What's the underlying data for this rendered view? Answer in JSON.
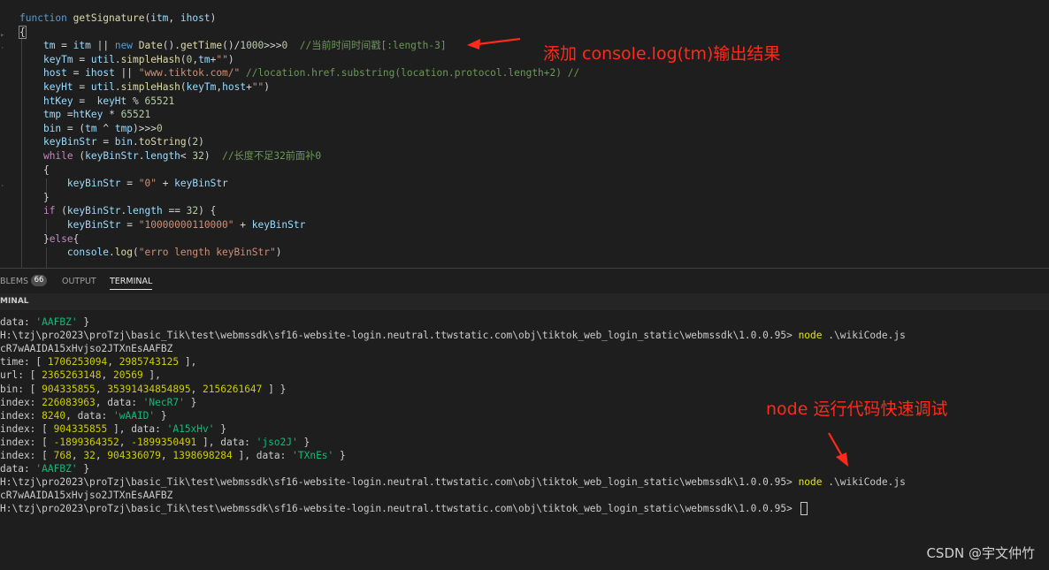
{
  "editor": {
    "lines": [
      [
        {
          "t": "function ",
          "c": "kw"
        },
        {
          "t": "getSignature",
          "c": "fn"
        },
        {
          "t": "(",
          "c": ""
        },
        {
          "t": "itm",
          "c": "var"
        },
        {
          "t": ", ",
          "c": ""
        },
        {
          "t": "ihost",
          "c": "var"
        },
        {
          "t": ")",
          "c": ""
        }
      ],
      [
        {
          "t": "{",
          "c": "brace-box"
        }
      ],
      [
        {
          "t": "    ",
          "c": ""
        },
        {
          "t": "tm",
          "c": "var"
        },
        {
          "t": " = ",
          "c": ""
        },
        {
          "t": "itm",
          "c": "var"
        },
        {
          "t": " || ",
          "c": ""
        },
        {
          "t": "new ",
          "c": "kw"
        },
        {
          "t": "Date",
          "c": "fn"
        },
        {
          "t": "().",
          "c": ""
        },
        {
          "t": "getTime",
          "c": "fn"
        },
        {
          "t": "()/",
          "c": ""
        },
        {
          "t": "1000",
          "c": "num"
        },
        {
          "t": ">>>",
          "c": ""
        },
        {
          "t": "0",
          "c": "num"
        },
        {
          "t": "  //当前时间时间戳[:length-3]",
          "c": "cmt"
        }
      ],
      [
        {
          "t": "    ",
          "c": ""
        },
        {
          "t": "keyTm",
          "c": "var"
        },
        {
          "t": " = ",
          "c": ""
        },
        {
          "t": "util",
          "c": "var"
        },
        {
          "t": ".",
          "c": ""
        },
        {
          "t": "simpleHash",
          "c": "fn"
        },
        {
          "t": "(",
          "c": ""
        },
        {
          "t": "0",
          "c": "num"
        },
        {
          "t": ",",
          "c": ""
        },
        {
          "t": "tm",
          "c": "var"
        },
        {
          "t": "+",
          "c": ""
        },
        {
          "t": "\"\"",
          "c": "str"
        },
        {
          "t": ")",
          "c": ""
        }
      ],
      [
        {
          "t": "    ",
          "c": ""
        },
        {
          "t": "host",
          "c": "var"
        },
        {
          "t": " = ",
          "c": ""
        },
        {
          "t": "ihost",
          "c": "var"
        },
        {
          "t": " || ",
          "c": ""
        },
        {
          "t": "\"www.tiktok.com/\"",
          "c": "str"
        },
        {
          "t": " //location.href.substring(location.protocol.length+2) //",
          "c": "cmt"
        }
      ],
      [
        {
          "t": "    ",
          "c": ""
        },
        {
          "t": "keyHt",
          "c": "var"
        },
        {
          "t": " = ",
          "c": ""
        },
        {
          "t": "util",
          "c": "var"
        },
        {
          "t": ".",
          "c": ""
        },
        {
          "t": "simpleHash",
          "c": "fn"
        },
        {
          "t": "(",
          "c": ""
        },
        {
          "t": "keyTm",
          "c": "var"
        },
        {
          "t": ",",
          "c": ""
        },
        {
          "t": "host",
          "c": "var"
        },
        {
          "t": "+",
          "c": ""
        },
        {
          "t": "\"\"",
          "c": "str"
        },
        {
          "t": ")",
          "c": ""
        }
      ],
      [
        {
          "t": "    ",
          "c": ""
        },
        {
          "t": "htKey",
          "c": "var"
        },
        {
          "t": " =  ",
          "c": ""
        },
        {
          "t": "keyHt",
          "c": "var"
        },
        {
          "t": " % ",
          "c": ""
        },
        {
          "t": "65521",
          "c": "num"
        }
      ],
      [
        {
          "t": "    ",
          "c": ""
        },
        {
          "t": "tmp",
          "c": "var"
        },
        {
          "t": " =",
          "c": ""
        },
        {
          "t": "htKey",
          "c": "var"
        },
        {
          "t": " * ",
          "c": ""
        },
        {
          "t": "65521",
          "c": "num"
        }
      ],
      [
        {
          "t": "    ",
          "c": ""
        },
        {
          "t": "bin",
          "c": "var"
        },
        {
          "t": " = (",
          "c": ""
        },
        {
          "t": "tm",
          "c": "var"
        },
        {
          "t": " ^ ",
          "c": ""
        },
        {
          "t": "tmp",
          "c": "var"
        },
        {
          "t": ")>>>",
          "c": ""
        },
        {
          "t": "0",
          "c": "num"
        }
      ],
      [
        {
          "t": "    ",
          "c": ""
        },
        {
          "t": "keyBinStr",
          "c": "var"
        },
        {
          "t": " = ",
          "c": ""
        },
        {
          "t": "bin",
          "c": "var"
        },
        {
          "t": ".",
          "c": ""
        },
        {
          "t": "toString",
          "c": "fn"
        },
        {
          "t": "(",
          "c": ""
        },
        {
          "t": "2",
          "c": "num"
        },
        {
          "t": ")",
          "c": ""
        }
      ],
      [
        {
          "t": "    ",
          "c": ""
        },
        {
          "t": "while",
          "c": "kw2"
        },
        {
          "t": " (",
          "c": ""
        },
        {
          "t": "keyBinStr",
          "c": "var"
        },
        {
          "t": ".",
          "c": ""
        },
        {
          "t": "length",
          "c": "var"
        },
        {
          "t": "< ",
          "c": ""
        },
        {
          "t": "32",
          "c": "num"
        },
        {
          "t": ")  ",
          "c": ""
        },
        {
          "t": "//长度不足32前面补0",
          "c": "cmt"
        }
      ],
      [
        {
          "t": "    {",
          "c": ""
        }
      ],
      [
        {
          "t": "        ",
          "c": ""
        },
        {
          "t": "keyBinStr",
          "c": "var"
        },
        {
          "t": " = ",
          "c": ""
        },
        {
          "t": "\"0\"",
          "c": "str"
        },
        {
          "t": " + ",
          "c": ""
        },
        {
          "t": "keyBinStr",
          "c": "var"
        }
      ],
      [
        {
          "t": "    }",
          "c": ""
        }
      ],
      [
        {
          "t": "    ",
          "c": ""
        },
        {
          "t": "if",
          "c": "kw2"
        },
        {
          "t": " (",
          "c": ""
        },
        {
          "t": "keyBinStr",
          "c": "var"
        },
        {
          "t": ".",
          "c": ""
        },
        {
          "t": "length",
          "c": "var"
        },
        {
          "t": " == ",
          "c": ""
        },
        {
          "t": "32",
          "c": "num"
        },
        {
          "t": ") {",
          "c": ""
        }
      ],
      [
        {
          "t": "        ",
          "c": ""
        },
        {
          "t": "keyBinStr",
          "c": "var"
        },
        {
          "t": " = ",
          "c": ""
        },
        {
          "t": "\"10000000110000\"",
          "c": "str"
        },
        {
          "t": " + ",
          "c": ""
        },
        {
          "t": "keyBinStr",
          "c": "var"
        }
      ],
      [
        {
          "t": "    }",
          "c": ""
        },
        {
          "t": "else",
          "c": "kw2"
        },
        {
          "t": "{",
          "c": ""
        }
      ],
      [
        {
          "t": "        ",
          "c": ""
        },
        {
          "t": "console",
          "c": "var"
        },
        {
          "t": ".",
          "c": ""
        },
        {
          "t": "log",
          "c": "fn"
        },
        {
          "t": "(",
          "c": ""
        },
        {
          "t": "\"erro length keyBinStr\"",
          "c": "str"
        },
        {
          "t": ")",
          "c": ""
        }
      ]
    ],
    "annotation_top": "添加 console.log(tm)输出结果"
  },
  "panel": {
    "tabs": [
      {
        "label": "BLEMS",
        "badge": "66"
      },
      {
        "label": "OUTPUT",
        "badge": ""
      },
      {
        "label": "TERMINAL",
        "badge": ""
      }
    ],
    "terminal_header": "MINAL"
  },
  "terminal": {
    "lines": [
      [
        {
          "t": "data: ",
          "c": ""
        },
        {
          "t": "'AAFBZ'",
          "c": "t-str"
        },
        {
          "t": " }",
          "c": ""
        }
      ],
      [
        {
          "t": "H:\\tzj\\pro2023\\proTzj\\basic_Tik\\test\\webmssdk\\sf16-website-login.neutral.ttwstatic.com\\obj\\tiktok_web_login_static\\webmssdk\\1.0.0.95> ",
          "c": ""
        },
        {
          "t": "node",
          "c": "t-cmd"
        },
        {
          "t": " .\\wikiCode.js",
          "c": ""
        }
      ],
      [
        {
          "t": "cR7wAAIDA15xHvjso2JTXnEsAAFBZ",
          "c": ""
        }
      ],
      [
        {
          "t": "time: [ ",
          "c": ""
        },
        {
          "t": "1706253094",
          "c": "t-num"
        },
        {
          "t": ", ",
          "c": ""
        },
        {
          "t": "2985743125",
          "c": "t-num"
        },
        {
          "t": " ],",
          "c": ""
        }
      ],
      [
        {
          "t": "url: [ ",
          "c": ""
        },
        {
          "t": "2365263148",
          "c": "t-num"
        },
        {
          "t": ", ",
          "c": ""
        },
        {
          "t": "20569",
          "c": "t-num"
        },
        {
          "t": " ],",
          "c": ""
        }
      ],
      [
        {
          "t": "bin: [ ",
          "c": ""
        },
        {
          "t": "904335855",
          "c": "t-num"
        },
        {
          "t": ", ",
          "c": ""
        },
        {
          "t": "35391434854895",
          "c": "t-num"
        },
        {
          "t": ", ",
          "c": ""
        },
        {
          "t": "2156261647",
          "c": "t-num"
        },
        {
          "t": " ] }",
          "c": ""
        }
      ],
      [
        {
          "t": "index: ",
          "c": ""
        },
        {
          "t": "226083963",
          "c": "t-num"
        },
        {
          "t": ", data: ",
          "c": ""
        },
        {
          "t": "'NecR7'",
          "c": "t-str"
        },
        {
          "t": " }",
          "c": ""
        }
      ],
      [
        {
          "t": "index: ",
          "c": ""
        },
        {
          "t": "8240",
          "c": "t-num"
        },
        {
          "t": ", data: ",
          "c": ""
        },
        {
          "t": "'wAAID'",
          "c": "t-str"
        },
        {
          "t": " }",
          "c": ""
        }
      ],
      [
        {
          "t": "index: [ ",
          "c": ""
        },
        {
          "t": "904335855",
          "c": "t-num"
        },
        {
          "t": " ], data: ",
          "c": ""
        },
        {
          "t": "'A15xHv'",
          "c": "t-str"
        },
        {
          "t": " }",
          "c": ""
        }
      ],
      [
        {
          "t": "index: [ ",
          "c": ""
        },
        {
          "t": "-1899364352",
          "c": "t-num"
        },
        {
          "t": ", ",
          "c": ""
        },
        {
          "t": "-1899350491",
          "c": "t-num"
        },
        {
          "t": " ], data: ",
          "c": ""
        },
        {
          "t": "'jso2J'",
          "c": "t-str"
        },
        {
          "t": " }",
          "c": ""
        }
      ],
      [
        {
          "t": "index: [ ",
          "c": ""
        },
        {
          "t": "768",
          "c": "t-num"
        },
        {
          "t": ", ",
          "c": ""
        },
        {
          "t": "32",
          "c": "t-num"
        },
        {
          "t": ", ",
          "c": ""
        },
        {
          "t": "904336079",
          "c": "t-num"
        },
        {
          "t": ", ",
          "c": ""
        },
        {
          "t": "1398698284",
          "c": "t-num"
        },
        {
          "t": " ], data: ",
          "c": ""
        },
        {
          "t": "'TXnEs'",
          "c": "t-str"
        },
        {
          "t": " }",
          "c": ""
        }
      ],
      [
        {
          "t": "data: ",
          "c": ""
        },
        {
          "t": "'AAFBZ'",
          "c": "t-str"
        },
        {
          "t": " }",
          "c": ""
        }
      ],
      [
        {
          "t": "H:\\tzj\\pro2023\\proTzj\\basic_Tik\\test\\webmssdk\\sf16-website-login.neutral.ttwstatic.com\\obj\\tiktok_web_login_static\\webmssdk\\1.0.0.95> ",
          "c": ""
        },
        {
          "t": "node",
          "c": "t-cmd"
        },
        {
          "t": " .\\wikiCode.js",
          "c": ""
        }
      ],
      [
        {
          "t": "cR7wAAIDA15xHvjso2JTXnEsAAFBZ",
          "c": ""
        }
      ],
      [
        {
          "t": "H:\\tzj\\pro2023\\proTzj\\basic_Tik\\test\\webmssdk\\sf16-website-login.neutral.ttwstatic.com\\obj\\tiktok_web_login_static\\webmssdk\\1.0.0.95> ",
          "c": ""
        }
      ]
    ],
    "annotation_bottom": "node 运行代码快速调试"
  },
  "watermark": "CSDN @宇文仲竹",
  "colors": {
    "annotation": "#ff2a1a",
    "editor_bg": "#1e1e1e",
    "terminal_header_bg": "#252526"
  }
}
